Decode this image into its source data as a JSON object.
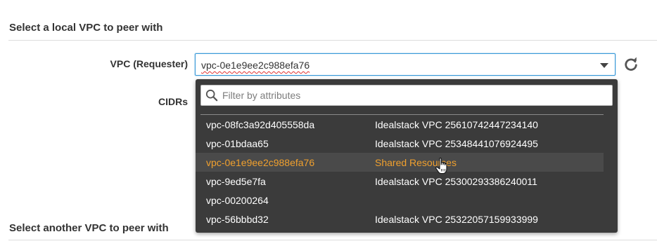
{
  "sections": {
    "local_title": "Select a local VPC to peer with",
    "another_title": "Select another VPC to peer with"
  },
  "form": {
    "vpc_label": "VPC (Requester)",
    "cidrs_label": "CIDRs",
    "selected_vpc": "vpc-0e1e9ee2c988efa76"
  },
  "dropdown": {
    "filter_placeholder": "Filter by attributes",
    "options": [
      {
        "id": "vpc-08fc3a92d405558da",
        "name": "Idealstack VPC 25610742447234140",
        "selected": false
      },
      {
        "id": "vpc-01bdaa65",
        "name": "Idealstack VPC 25348441076924495",
        "selected": false
      },
      {
        "id": "vpc-0e1e9ee2c988efa76",
        "name": "Shared Resources",
        "selected": true
      },
      {
        "id": "vpc-9ed5e7fa",
        "name": "Idealstack VPC 25300293386240011",
        "selected": false
      },
      {
        "id": "vpc-00200264",
        "name": "",
        "selected": false
      },
      {
        "id": "vpc-56bbbd32",
        "name": "Idealstack VPC 25322057159933999",
        "selected": false
      }
    ]
  },
  "colors": {
    "accent_highlight": "#f0a02e",
    "dropdown_bg": "#3b3b3b",
    "focus_border": "#3b9ad9"
  },
  "icons": {
    "refresh": "refresh-icon",
    "caret": "caret-down-icon",
    "search": "search-icon",
    "cursor": "hand-pointer-cursor-icon"
  }
}
